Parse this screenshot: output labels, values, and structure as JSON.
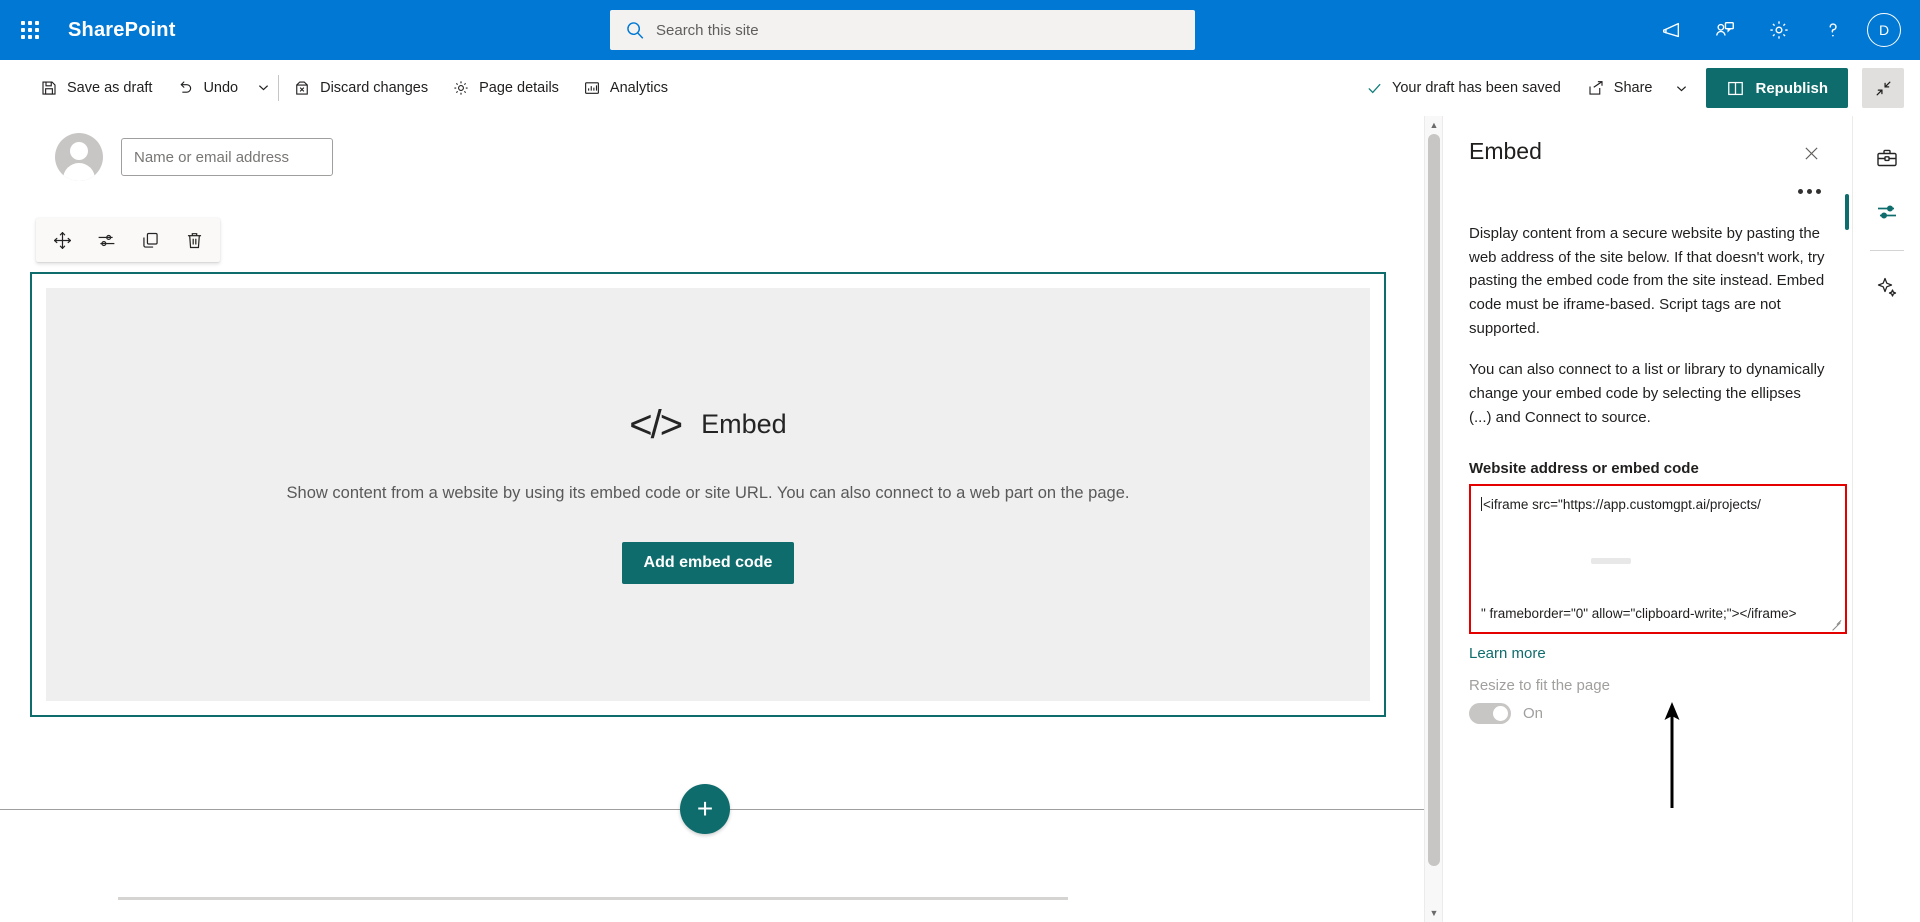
{
  "suite": {
    "brand": "SharePoint",
    "waffle_name": "app-launcher",
    "search": {
      "placeholder": "Search this site"
    },
    "icons": [
      {
        "name": "megaphone-icon",
        "title": "Announcements"
      },
      {
        "name": "feedback-icon",
        "title": "Feedback"
      },
      {
        "name": "gear-icon",
        "title": "Settings"
      },
      {
        "name": "help-icon",
        "title": "Help"
      }
    ],
    "avatar_initial": "D"
  },
  "commandbar": {
    "save_as_draft": "Save as draft",
    "undo": "Undo",
    "discard_changes": "Discard changes",
    "page_details": "Page details",
    "analytics": "Analytics",
    "draft_status": "Your draft has been saved",
    "share": "Share",
    "republish": "Republish"
  },
  "canvas": {
    "byline_placeholder": "Name or email address",
    "webpart_tools": [
      {
        "name": "move-webpart-icon",
        "title": "Move web part"
      },
      {
        "name": "edit-webpart-icon",
        "title": "Edit web part"
      },
      {
        "name": "duplicate-webpart-icon",
        "title": "Duplicate web part"
      },
      {
        "name": "delete-webpart-icon",
        "title": "Delete web part"
      }
    ],
    "webpart": {
      "icon_glyph": "</>",
      "title": "Embed",
      "description": "Show content from a website by using its embed code or site URL. You can also connect to a web part on the page.",
      "action_label": "Add embed code"
    },
    "add_section_label": "+"
  },
  "pane": {
    "title": "Embed",
    "paragraph_1": "Display content from a secure website by pasting the web address of the site below. If that doesn't work, try pasting the embed code from the site instead. Embed code must be iframe-based. Script tags are not supported.",
    "paragraph_2": "You can also connect to a list or library to dynamically change your embed code by selecting the ellipses (...) and Connect to source.",
    "field_label": "Website address or embed code",
    "code_value_start": "<iframe src=\"https://app.customgpt.ai/projects/",
    "code_value_end": "\" frameborder=\"0\" allow=\"clipboard-write;\"></iframe>",
    "learn_more": "Learn more",
    "resize_label": "Resize to fit the page",
    "resize_state": "On"
  },
  "rail": {
    "items": [
      {
        "name": "toolbox-icon",
        "title": "Toolbox",
        "selected": false
      },
      {
        "name": "properties-icon",
        "title": "Web part properties",
        "selected": true
      },
      {
        "name": "copilot-sparkle-icon",
        "title": "Copilot",
        "selected": false
      }
    ]
  },
  "colors": {
    "suitebar": "#0078d4",
    "accent_teal": "#0f6c6c",
    "error_red": "#e50000",
    "placeholder_bg": "#efefef"
  }
}
